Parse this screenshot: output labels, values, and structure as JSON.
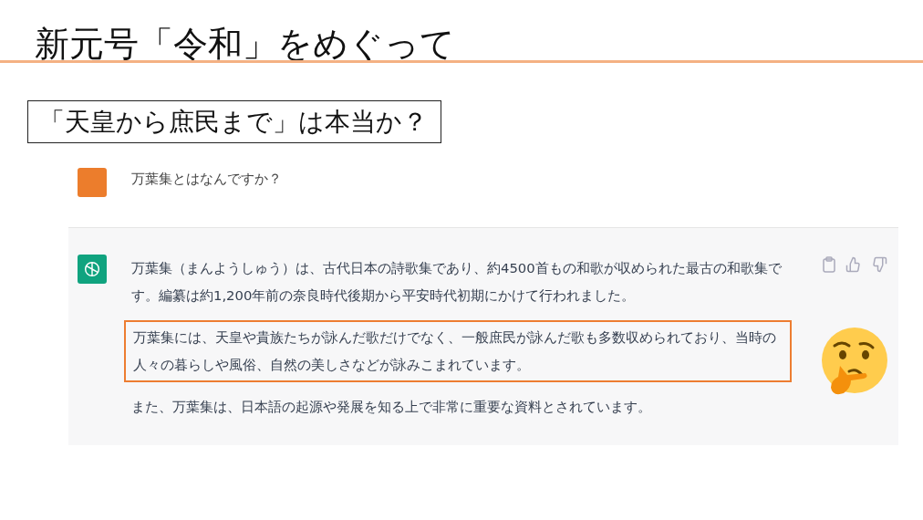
{
  "slide_title": "新元号「令和」をめぐって",
  "subtitle": "「天皇から庶民まで」は本当か？",
  "chat": {
    "messages": [
      {
        "kind": "user",
        "text": "万葉集とはなんですか？"
      },
      {
        "kind": "assistant",
        "paragraphs": [
          {
            "text": "万葉集（まんようしゅう）は、古代日本の詩歌集であり、約4500首もの和歌が収められた最古の和歌集です。編纂は約1,200年前の奈良時代後期から平安時代初期にかけて行われました。",
            "highlighted": false
          },
          {
            "text": "万葉集には、天皇や貴族たちが詠んだ歌だけでなく、一般庶民が詠んだ歌も多数収められており、当時の人々の暮らしや風俗、自然の美しさなどが詠みこまれています。",
            "highlighted": true
          },
          {
            "text": "また、万葉集は、日本語の起源や発展を知る上で非常に重要な資料とされています。",
            "highlighted": false
          }
        ]
      }
    ]
  }
}
